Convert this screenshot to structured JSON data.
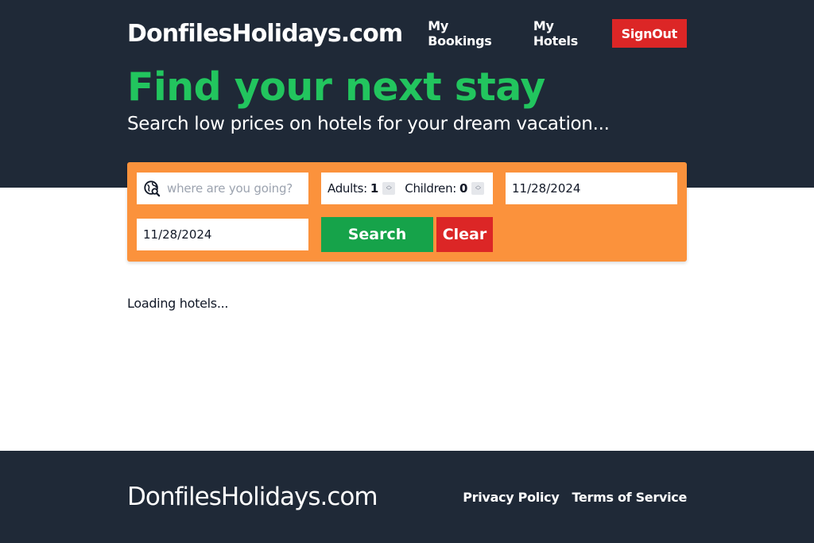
{
  "header": {
    "logo": "DonfilesHolidays.com",
    "nav": {
      "my_bookings": "My Bookings",
      "my_hotels": "My Hotels",
      "sign_out": "SignOut"
    }
  },
  "hero": {
    "title": "Find your next stay",
    "subtitle": "Search low prices on hotels for your dream vacation..."
  },
  "search": {
    "destination_placeholder": "where are you going?",
    "destination_icon": "globe-search-icon",
    "adults_label": "Adults:",
    "adults_value": "1",
    "children_label": "Children:",
    "children_value": "0",
    "check_in": "11/28/2024",
    "check_out": "11/28/2024",
    "search_button": "Search",
    "clear_button": "Clear"
  },
  "main": {
    "status": "Loading hotels..."
  },
  "footer": {
    "logo": "DonfilesHolidays.com",
    "privacy": "Privacy Policy",
    "terms": "Terms of Service"
  },
  "colors": {
    "dark": "#1f2937",
    "accent_green": "#22c55e",
    "search_orange": "#fb923c",
    "search_button": "#16a34a",
    "danger": "#dc2626"
  }
}
